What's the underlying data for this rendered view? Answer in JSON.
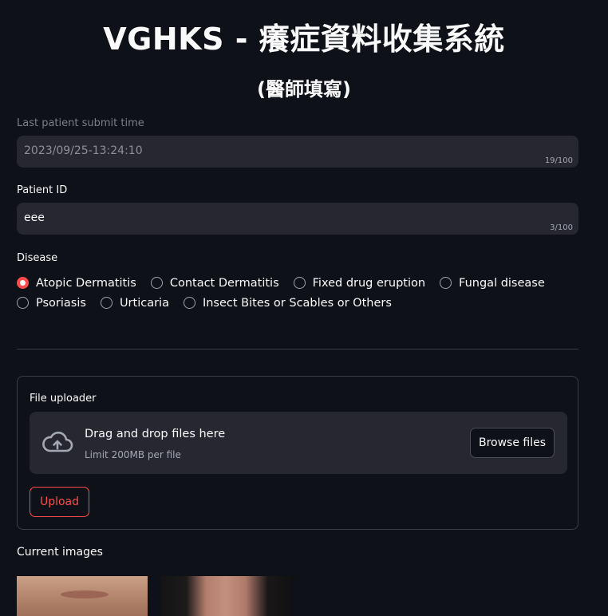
{
  "header": {
    "title": "VGHKS - 癢症資料收集系統",
    "subtitle": "(醫師填寫)"
  },
  "last_submit": {
    "label": "Last patient submit time",
    "value": "2023/09/25-13:24:10",
    "count": "19/100"
  },
  "patient_id": {
    "label": "Patient ID",
    "value": "eee",
    "count": "3/100"
  },
  "disease": {
    "label": "Disease",
    "options_row1": [
      "Atopic Dermatitis",
      "Contact Dermatitis",
      "Fixed drug eruption",
      "Fungal disease"
    ],
    "options_row2": [
      "Psoriasis",
      "Urticaria",
      "Insect Bites or Scables or Others"
    ],
    "selected": "Atopic Dermatitis"
  },
  "uploader": {
    "label": "File uploader",
    "dropzone_title": "Drag and drop files here",
    "dropzone_sub": "Limit 200MB per file",
    "browse_label": "Browse files",
    "upload_label": "Upload",
    "icon": "cloud-upload-icon"
  },
  "current_images": {
    "label": "Current images"
  },
  "colors": {
    "background": "#0e1117",
    "input_bg": "#262730",
    "accent": "#ff4b4b"
  }
}
